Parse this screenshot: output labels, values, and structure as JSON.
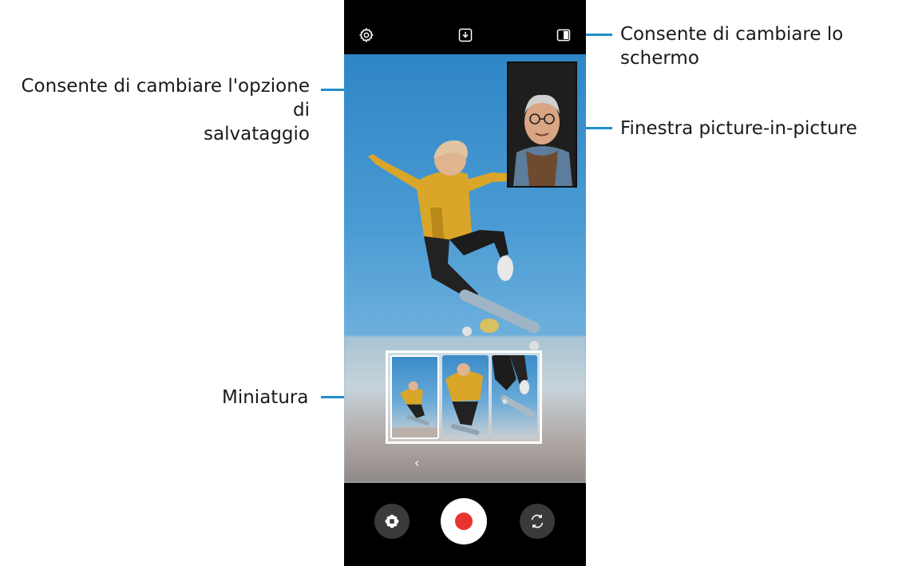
{
  "callouts": {
    "switch_screen": "Consente di cambiare lo schermo",
    "save_option_line1": "Consente di cambiare l'opzione di",
    "save_option_line2": "salvataggio",
    "pip_window": "Finestra picture-in-picture",
    "thumbnail": "Miniatura"
  },
  "icons": {
    "settings": "gear-icon",
    "save_option": "download-icon",
    "screen_layout": "split-screen-icon",
    "effects": "flower-icon",
    "record": "record-icon",
    "switch_camera": "rotate-camera-icon",
    "thumbnail_nav": "chevron-left-icon"
  },
  "glyphs": {
    "chevron": "‹"
  },
  "colors": {
    "callout_line": "#1f8fc8",
    "record_dot": "#e8342f",
    "sky": "#4a9bd3",
    "hoodie": "#d9a62a"
  }
}
